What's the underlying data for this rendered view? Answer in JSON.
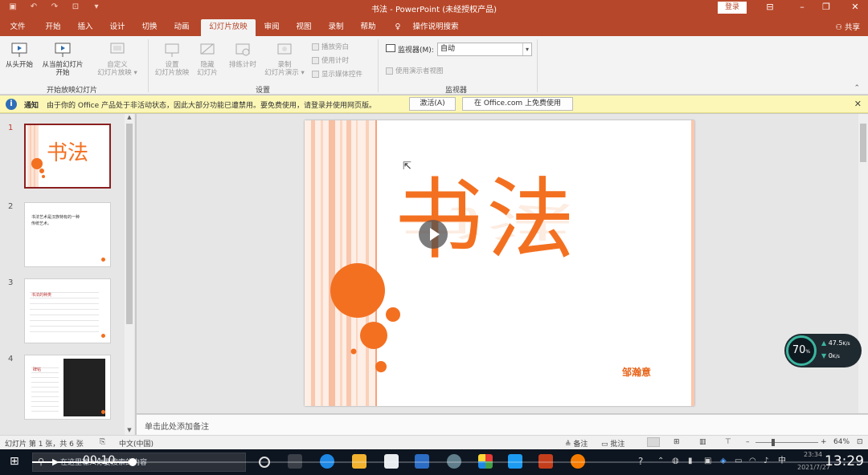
{
  "titlebar": {
    "title": "书法 - PowerPoint (未经授权产品)",
    "login_label": "登录",
    "qat_icons": [
      "save-icon",
      "undo-icon",
      "redo-icon",
      "from-beginning-icon",
      "customize-icon"
    ]
  },
  "tabs": [
    "文件",
    "开始",
    "插入",
    "设计",
    "切换",
    "动画",
    "幻灯片放映",
    "审阅",
    "视图",
    "录制",
    "帮助"
  ],
  "active_tab": "幻灯片放映",
  "tell_me": "操作说明搜索",
  "share_label": "共享",
  "ribbon": {
    "start_group": {
      "from_beginning": "从头开始",
      "from_current_line1": "从当前幻灯片",
      "from_current_line2": "开始",
      "custom_line1": "自定义",
      "custom_line2": "幻灯片放映",
      "label": "开始放映幻灯片"
    },
    "setup_group": {
      "setup_line1": "设置",
      "setup_line2": "幻灯片放映",
      "hide_line1": "隐藏",
      "hide_line2": "幻灯片",
      "rehearse": "排练计时",
      "record_line1": "录制",
      "record_line2": "幻灯片演示",
      "play_narrations": "播放旁白",
      "use_timings": "使用计时",
      "show_media_controls": "显示媒体控件",
      "label": "设置"
    },
    "monitors_group": {
      "monitor_label": "监视器(M):",
      "monitor_value": "自动",
      "presenter_view": "使用演示者视图",
      "label": "监视器"
    }
  },
  "notice": {
    "label": "通知",
    "message": "由于你的 Office 产品处于非活动状态，因此大部分功能已遭禁用。要免费使用，请登录并使用网页版。",
    "activate_button": "激活(A)",
    "web_button": "在 Office.com 上免费使用"
  },
  "thumbnails": [
    {
      "number": "1",
      "title": "书法"
    },
    {
      "number": "2",
      "text": "书法艺术是汉族特有的一种传统艺术。"
    },
    {
      "number": "3",
      "text": "书法的种类"
    },
    {
      "number": "4",
      "text": "碑帖"
    }
  ],
  "slide": {
    "title": "书法",
    "author": "邹瀚意"
  },
  "notes_placeholder": "单击此处添加备注",
  "statusbar": {
    "slide_info": "幻灯片 第 1 张，共 6 张",
    "language": "中文(中国)",
    "notes_label": "备注",
    "comments_label": "批注",
    "zoom": "64%"
  },
  "netwidget": {
    "percent": "70",
    "up_speed": "47.5",
    "down_speed": "0"
  },
  "taskbar": {
    "search_text": "在这里输入你要搜索的内容",
    "video_time": "00:10",
    "clock_big": "13:29",
    "clock_small": "23:34",
    "date_small": "2021/7/27",
    "ime": "中",
    "video_progress": 0.12
  },
  "colors": {
    "ppt_red": "#b7472a",
    "slide_orange": "#f37021",
    "notice_yellow": "#fcf7b6"
  }
}
